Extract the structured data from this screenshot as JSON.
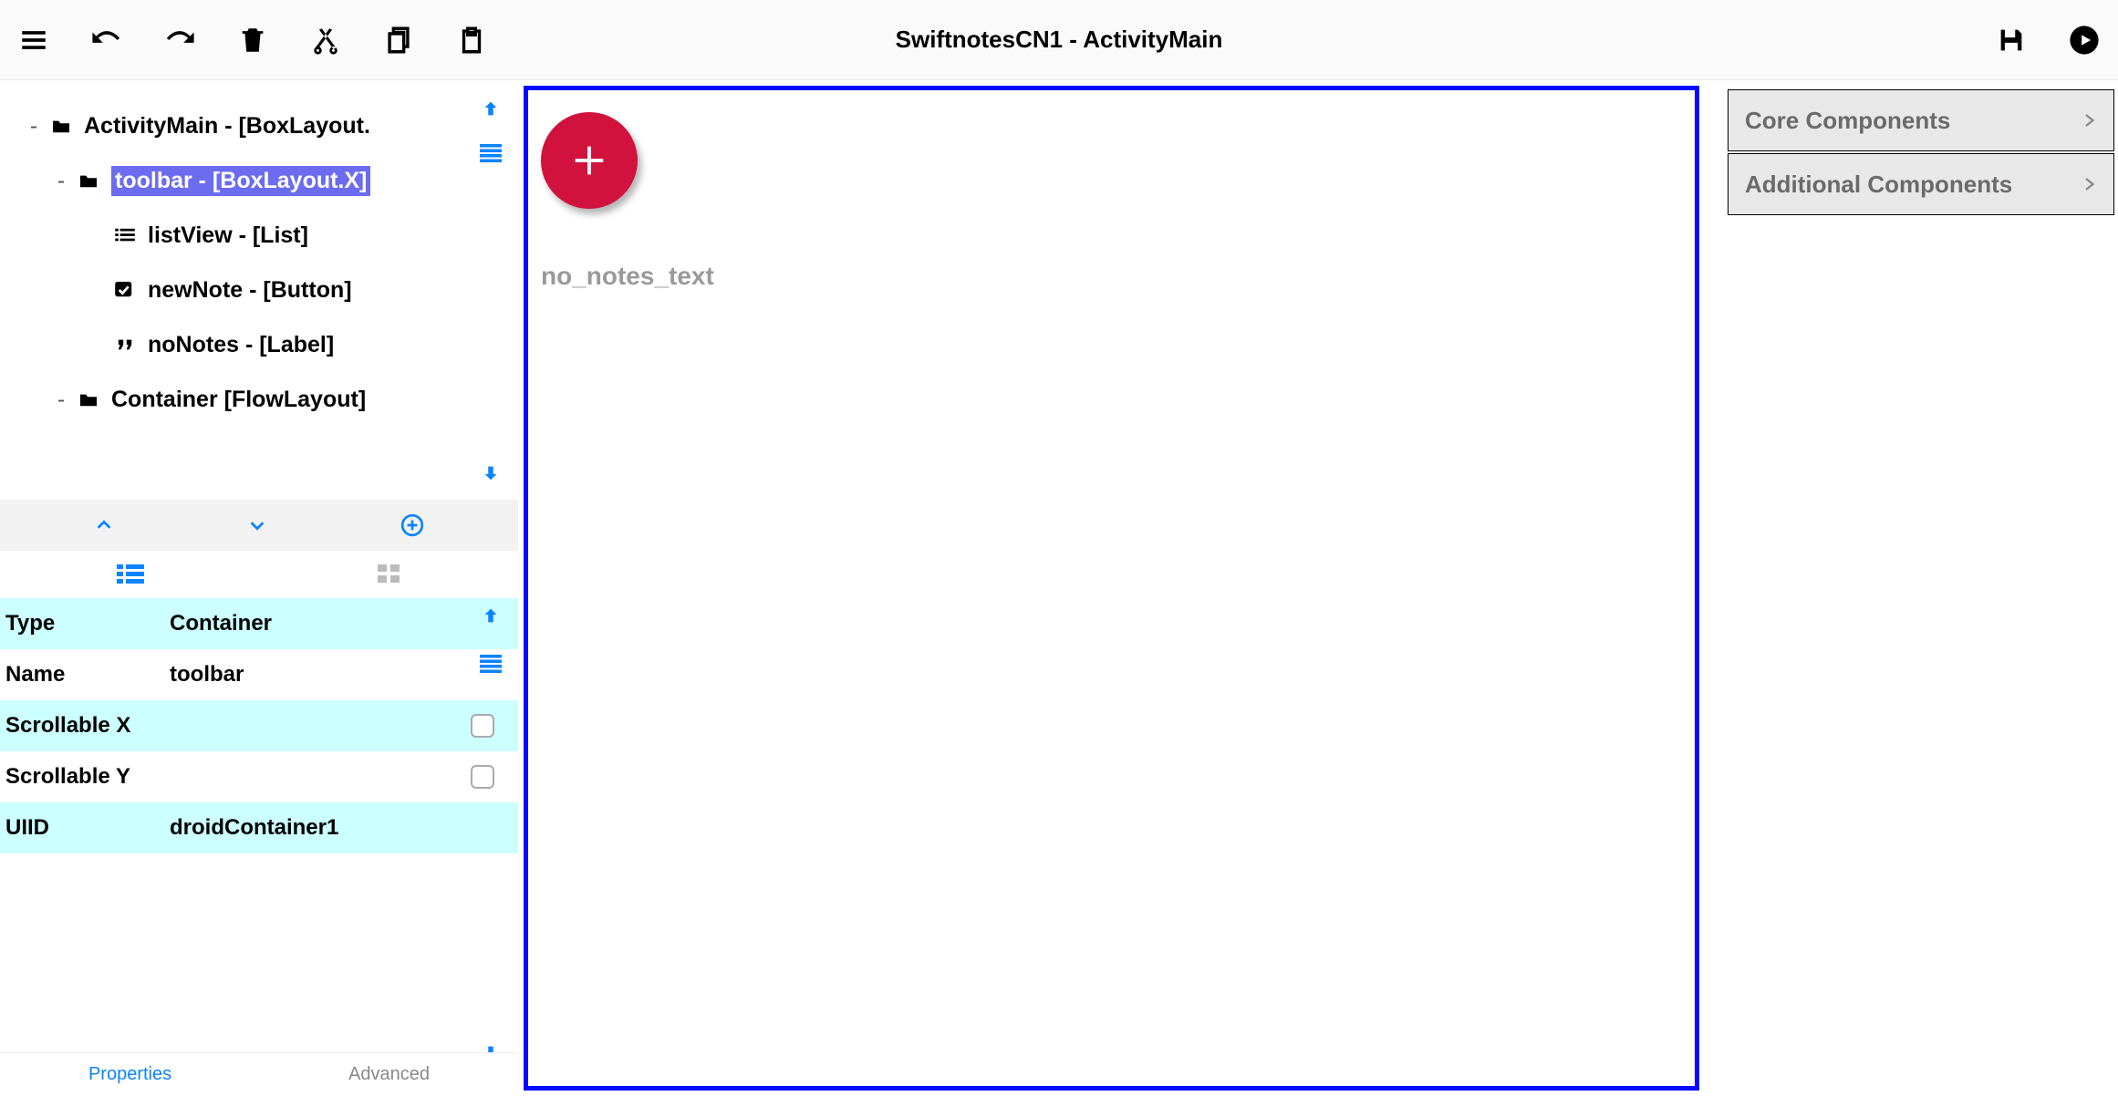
{
  "title": "SwiftnotesCN1 - ActivityMain",
  "tree": [
    {
      "indent": 0,
      "toggle": "-",
      "icon": "folder",
      "label": "ActivityMain - [BoxLayout.",
      "selected": false
    },
    {
      "indent": 1,
      "toggle": "-",
      "icon": "folder",
      "label": "toolbar - [BoxLayout.X]",
      "selected": true
    },
    {
      "indent": 2,
      "toggle": "",
      "icon": "list",
      "label": "listView - [List]",
      "selected": false
    },
    {
      "indent": 2,
      "toggle": "",
      "icon": "check",
      "label": "newNote - [Button]",
      "selected": false
    },
    {
      "indent": 2,
      "toggle": "",
      "icon": "quote",
      "label": "noNotes - [Label]",
      "selected": false
    },
    {
      "indent": 1,
      "toggle": "-",
      "icon": "folder",
      "label": "Container [FlowLayout]",
      "selected": false
    }
  ],
  "props": [
    {
      "k": "Type",
      "v": "Container",
      "check": null,
      "odd": true
    },
    {
      "k": "Name",
      "v": "toolbar",
      "check": null,
      "odd": false
    },
    {
      "k": "Scrollable X",
      "v": "",
      "check": false,
      "odd": true
    },
    {
      "k": "Scrollable Y",
      "v": "",
      "check": false,
      "odd": false
    },
    {
      "k": "UIID",
      "v": "droidContainer1",
      "check": null,
      "odd": true
    }
  ],
  "propTabs": {
    "active": "Properties",
    "inactive": "Advanced"
  },
  "canvas": {
    "noNotesText": "no_notes_text"
  },
  "rightPanel": {
    "core": "Core Components",
    "additional": "Additional Components"
  }
}
